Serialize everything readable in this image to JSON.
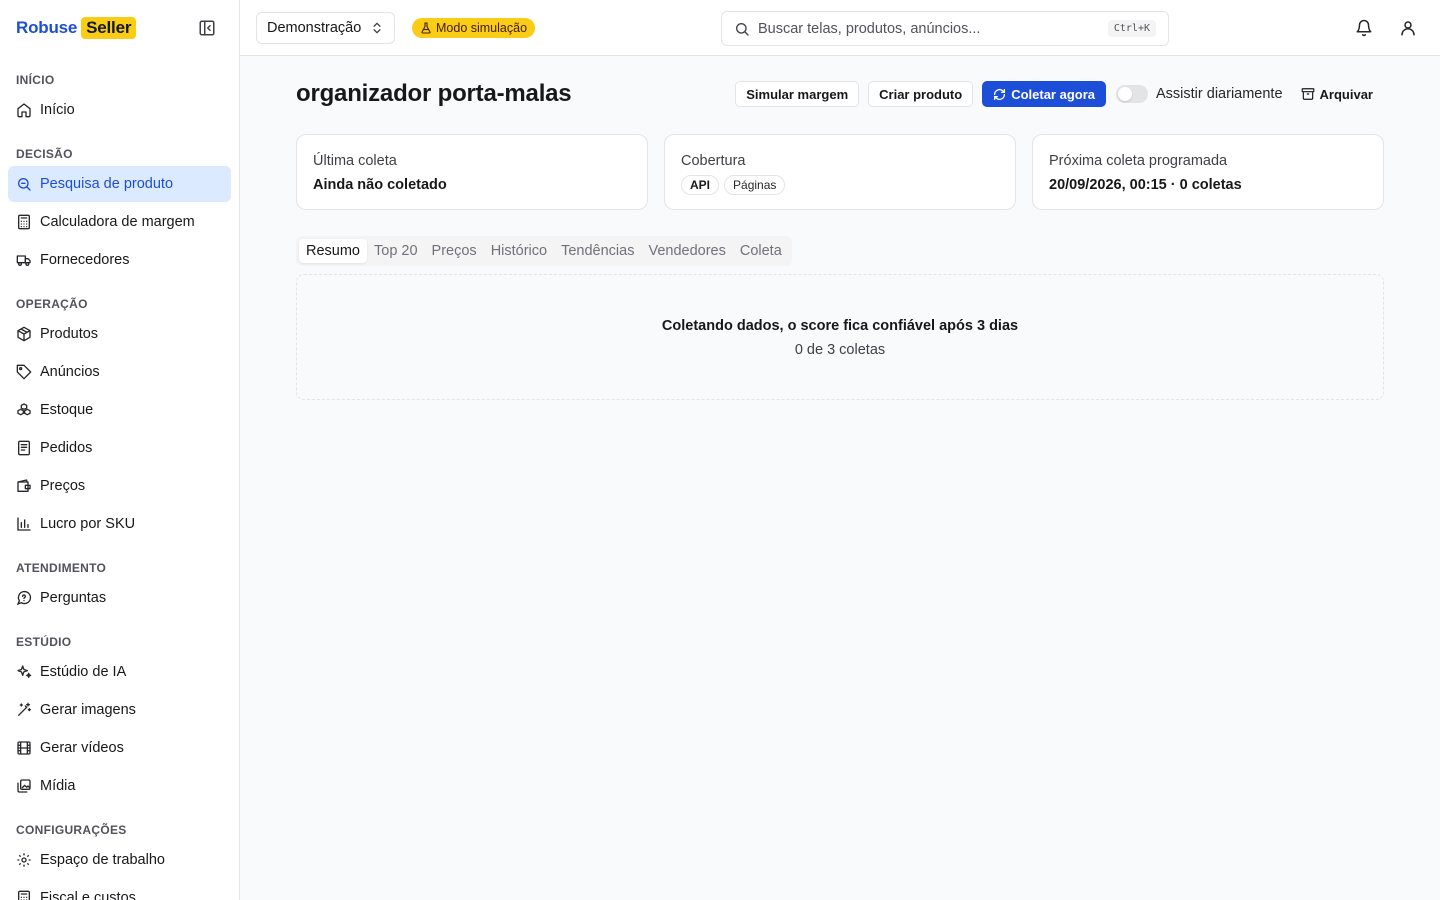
{
  "brand": {
    "name": "Robuse",
    "badge": "Seller"
  },
  "sidebar": {
    "sections": [
      {
        "label": "INÍCIO",
        "items": [
          {
            "label": "Início",
            "icon": "home-icon"
          }
        ]
      },
      {
        "label": "DECISÃO",
        "items": [
          {
            "label": "Pesquisa de produto",
            "icon": "search-icon",
            "active": true
          },
          {
            "label": "Calculadora de margem",
            "icon": "calculator-icon"
          },
          {
            "label": "Fornecedores",
            "icon": "truck-icon"
          }
        ]
      },
      {
        "label": "OPERAÇÃO",
        "items": [
          {
            "label": "Produtos",
            "icon": "package-icon"
          },
          {
            "label": "Anúncios",
            "icon": "tag-icon"
          },
          {
            "label": "Estoque",
            "icon": "boxes-icon"
          },
          {
            "label": "Pedidos",
            "icon": "receipt-icon"
          },
          {
            "label": "Preços",
            "icon": "wallet-icon"
          },
          {
            "label": "Lucro por SKU",
            "icon": "bar-chart-icon"
          }
        ]
      },
      {
        "label": "ATENDIMENTO",
        "items": [
          {
            "label": "Perguntas",
            "icon": "message-question-icon"
          }
        ]
      },
      {
        "label": "ESTÚDIO",
        "items": [
          {
            "label": "Estúdio de IA",
            "icon": "sparkles-icon"
          },
          {
            "label": "Gerar imagens",
            "icon": "wand-icon"
          },
          {
            "label": "Gerar vídeos",
            "icon": "film-icon"
          },
          {
            "label": "Mídia",
            "icon": "images-icon"
          }
        ]
      },
      {
        "label": "CONFIGURAÇÕES",
        "items": [
          {
            "label": "Espaço de trabalho",
            "icon": "gear-icon"
          },
          {
            "label": "Fiscal e custos",
            "icon": "calculator-icon"
          }
        ]
      }
    ]
  },
  "topbar": {
    "workspace": "Demonstração",
    "simulation_badge": "Modo simulação",
    "search_placeholder": "Buscar telas, produtos, anúncios...",
    "search_shortcut": "Ctrl+K"
  },
  "page": {
    "title": "organizador porta-malas",
    "actions": {
      "simulate": "Simular margem",
      "create": "Criar produto",
      "collect": "Coletar agora",
      "watch_daily": "Assistir diariamente",
      "watch_daily_on": false,
      "archive": "Arquivar"
    },
    "cards": {
      "last_collect": {
        "label": "Última coleta",
        "value": "Ainda não coletado"
      },
      "coverage": {
        "label": "Cobertura",
        "pills": [
          "API",
          "Páginas"
        ]
      },
      "next_collect": {
        "label": "Próxima coleta programada",
        "value": "20/09/2026, 00:15 · 0 coletas"
      }
    },
    "tabs": [
      "Resumo",
      "Top 20",
      "Preços",
      "Histórico",
      "Tendências",
      "Vendedores",
      "Coleta"
    ],
    "active_tab": "Resumo",
    "empty_state": {
      "title": "Coletando dados, o score fica confiável após 3 dias",
      "subtitle": "0 de 3 coletas"
    }
  },
  "colors": {
    "primary": "#1d4ed8",
    "badge": "#facc15",
    "active_nav_bg": "#dbeafe"
  }
}
